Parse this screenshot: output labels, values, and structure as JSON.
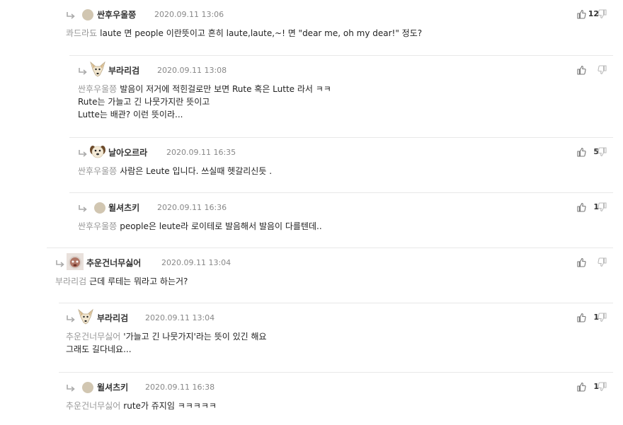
{
  "comments": [
    {
      "nick": "싼후우울쯩",
      "date": "2020.09.11 13:06",
      "likes": "12",
      "avatar": "dot",
      "mention": "콰드라됴",
      "lines": [
        "laute 면 people 이란뜻이고 흔히 laute,laute,~! 면 \"dear me, oh my dear!\" 정도?"
      ]
    },
    {
      "nick": "부라리검",
      "date": "2020.09.11 13:08",
      "likes": "",
      "avatar": "dog",
      "mention": "싼후우울쯩",
      "lines": [
        "발음이 저거에 적힌걸로만 보면 Rute 혹은 Lutte 라서 ㅋㅋ",
        "Rute는 가늘고 긴 나뭇가지란 뜻이고",
        "Lutte는 배관? 이런 뜻이라..."
      ]
    },
    {
      "nick": "날아오르라",
      "date": "2020.09.11 16:35",
      "likes": "5",
      "avatar": "puppy",
      "mention": "싼후우울쯩",
      "lines": [
        "사람은 Leute 입니다. 쓰실때 헷갈리신듯 ."
      ]
    },
    {
      "nick": "윌셔츠키",
      "date": "2020.09.11 16:36",
      "likes": "1",
      "avatar": "dot",
      "mention": "싼후우울쯩",
      "lines": [
        "people은 leute라 로이테로 발음해서 발음이 다를텐데.."
      ]
    },
    {
      "nick": "추운건너무싫어",
      "date": "2020.09.11 13:04",
      "likes": "",
      "avatar": "photo",
      "mention": "부라리검",
      "lines": [
        "근데 루테는 뭐라고 하는거?"
      ]
    },
    {
      "nick": "부라리검",
      "date": "2020.09.11 13:04",
      "likes": "1",
      "avatar": "dog",
      "mention": "추운건너무싫어",
      "lines": [
        "'가늘고 긴 나뭇가지'라는 뜻이 있긴 해요",
        "그래도 길다네요..."
      ]
    },
    {
      "nick": "윌셔츠키",
      "date": "2020.09.11 16:38",
      "likes": "1",
      "avatar": "dot",
      "mention": "추운건너무싫어",
      "lines": [
        "rute가 쥬지임 ㅋㅋㅋㅋㅋ"
      ]
    }
  ],
  "icons": {
    "reply": "reply-arrow-icon",
    "up": "thumbs-up-icon",
    "down": "thumbs-down-icon"
  },
  "colors": {
    "nick": "#333333",
    "date": "#888888",
    "mention": "#999999",
    "divider": "#e8e8e8"
  }
}
